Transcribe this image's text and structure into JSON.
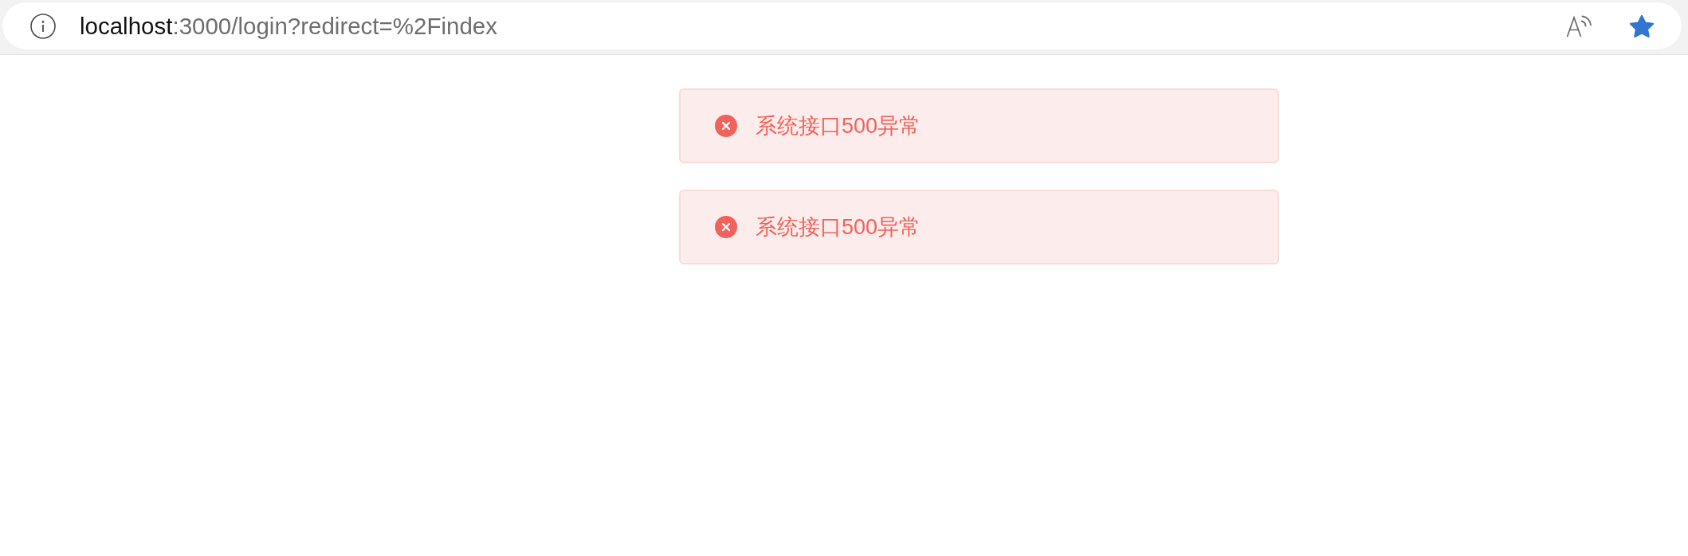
{
  "browser": {
    "address_bar": {
      "host": "localhost",
      "path": ":3000/login?redirect=%2Findex"
    },
    "favorited": true
  },
  "messages": [
    {
      "kind": "error",
      "text": "系统接口500异常"
    },
    {
      "kind": "error",
      "text": "系统接口500异常"
    }
  ]
}
